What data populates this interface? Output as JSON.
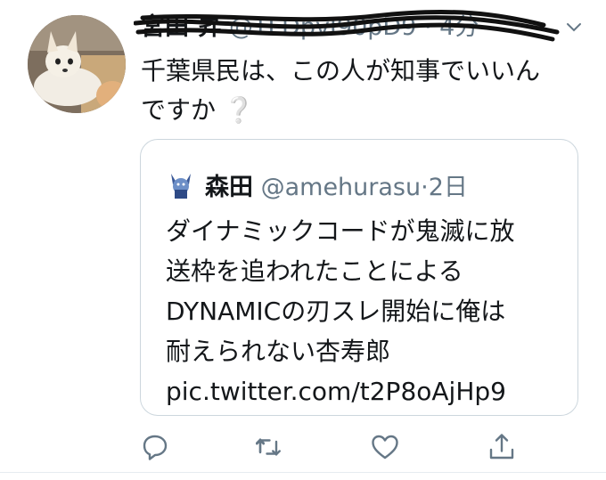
{
  "tweet": {
    "author_name": "宮田 昇",
    "handle": "@TFDpvI90pD9",
    "separator": " · ",
    "time": "4分",
    "text_line1": "千葉県民は、この人が知事でいいん",
    "text_line2": "ですか",
    "question_mark": "❔"
  },
  "quoted": {
    "name": "森田",
    "handle": "@amehurasu",
    "separator": "·",
    "time": "2日",
    "lines": [
      "ダイナミックコードが鬼滅に放",
      "送枠を追われたことによる",
      "DYNAMICの刃スレ開始に俺は",
      "耐えられない杏寿郎",
      "pic.twitter.com/t2P8oAjHp9"
    ]
  },
  "actions": {
    "reply_icon": "reply-icon",
    "retweet_icon": "retweet-icon",
    "like_icon": "heart-icon",
    "share_icon": "share-icon"
  },
  "colors": {
    "text": "#14171a",
    "secondary": "#657786",
    "border": "#ccd6dd",
    "icon": "#657786"
  }
}
